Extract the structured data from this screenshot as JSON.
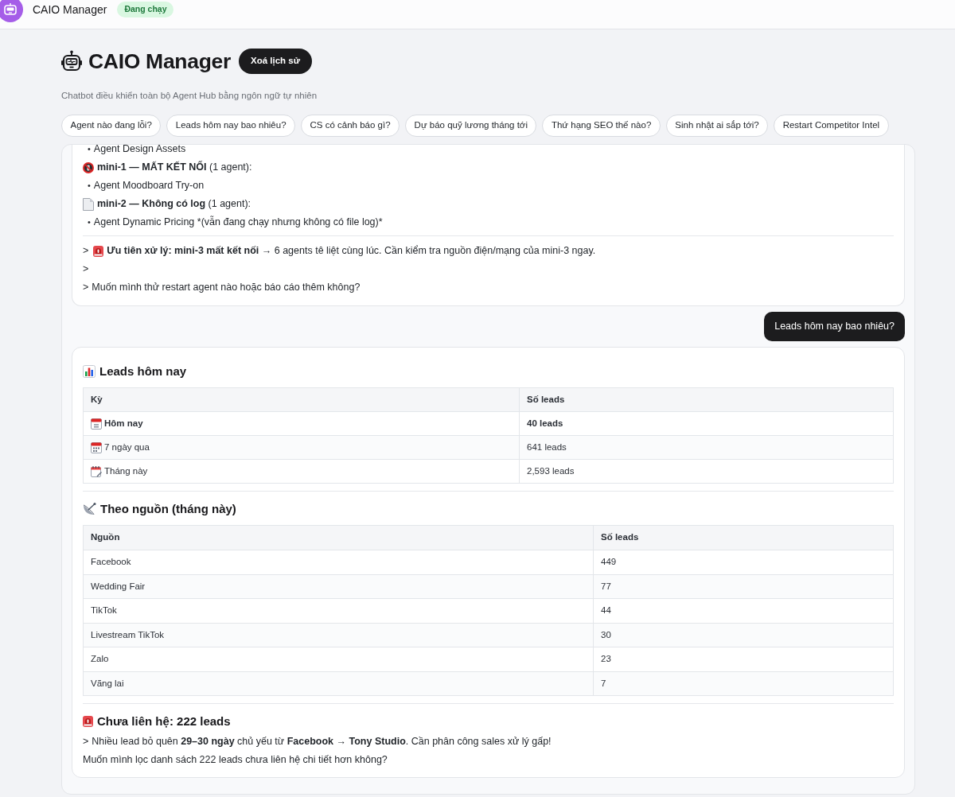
{
  "top_bar": {
    "title": "CAIO Manager",
    "status": "Đang chạy"
  },
  "header": {
    "title": "CAIO Manager",
    "clear_button": "Xoá lịch sử",
    "subtitle": "Chatbot điều khiển toàn bộ Agent Hub bằng ngôn ngữ tự nhiên"
  },
  "suggestions": [
    "Agent nào đang lỗi?",
    "Leads hôm nay bao nhiêu?",
    "CS có cảnh báo gì?",
    "Dự báo quỹ lương tháng tới",
    "Thứ hạng SEO thế nào?",
    "Sinh nhật ai sắp tới?",
    "Restart Competitor Intel"
  ],
  "messages": [
    {
      "kind": "assistant",
      "blocks": [
        {
          "kind": "bullet",
          "marker": "•",
          "text": "Agent Design Assets"
        },
        {
          "kind": "offline",
          "text": "**mini-1 — MẤT KẾT NỐI** (1 agent):"
        },
        {
          "kind": "bullet",
          "marker": "•",
          "text": "Agent Moodboard Try-on"
        },
        {
          "kind": "nolog",
          "text": "**mini-2 — Không có log** (1 agent):"
        },
        {
          "kind": "bullet",
          "marker": "•",
          "text": "Agent Dynamic Pricing *(vẫn đang chạy nhưng không có file log)*"
        },
        {
          "kind": "rule"
        },
        {
          "kind": "quote",
          "prefix": ">",
          "alert": true,
          "text": "**Ưu tiên xử lý: mini-3 mất kết nối** → 6 agents tê liệt cùng lúc. Cần kiểm tra nguồn điện/mạng của mini-3 ngay."
        },
        {
          "kind": "quote",
          "prefix": ">",
          "alert": false
        },
        {
          "kind": "quote",
          "prefix": ">",
          "alert": false,
          "text": "Muốn mình thử restart agent nào hoặc báo cáo thêm không?"
        }
      ]
    },
    {
      "kind": "user",
      "text": "Leads hôm nay bao nhiêu?"
    },
    {
      "kind": "assistant",
      "blocks": [
        {
          "kind": "heading",
          "alert": false,
          "text": "Leads hôm nay"
        },
        {
          "kind": "table",
          "columns": [
            "Kỳ",
            "Số leads"
          ],
          "rows": [
            {
              "cells": [
                "Hôm nay",
                "40 leads"
              ],
              "emphasized": true
            },
            {
              "cells": [
                "7 ngày qua",
                "641 leads"
              ],
              "emphasized": false
            },
            {
              "cells": [
                "Tháng này",
                "2,593 leads"
              ],
              "emphasized": false
            }
          ]
        },
        {
          "kind": "rule"
        },
        {
          "kind": "heading",
          "alert": false,
          "text": "Theo nguồn (tháng này)"
        },
        {
          "kind": "table",
          "columns": [
            "Nguồn",
            "Số leads"
          ],
          "rows": [
            {
              "cells": [
                "Facebook",
                "449"
              ],
              "emphasized": false
            },
            {
              "cells": [
                "Wedding Fair",
                "77"
              ],
              "emphasized": false
            },
            {
              "cells": [
                "TikTok",
                "44"
              ],
              "emphasized": false
            },
            {
              "cells": [
                "Livestream TikTok",
                "30"
              ],
              "emphasized": false
            },
            {
              "cells": [
                "Zalo",
                "23"
              ],
              "emphasized": false
            },
            {
              "cells": [
                "Vãng lai",
                "7"
              ],
              "emphasized": false
            }
          ]
        },
        {
          "kind": "rule"
        },
        {
          "kind": "heading",
          "alert": true,
          "text": "Chưa liên hệ: 222 leads"
        },
        {
          "kind": "quote",
          "prefix": ">",
          "alert": false,
          "text": "Nhiều lead bỏ quên **29–30 ngày** chủ yếu từ **Facebook → Tony Studio**. Cần phân công sales xử lý gấp!"
        },
        {
          "kind": "paragraph",
          "text": "Muốn mình lọc danh sách 222 leads chưa liên hệ chi tiết hơn không?"
        }
      ]
    }
  ]
}
